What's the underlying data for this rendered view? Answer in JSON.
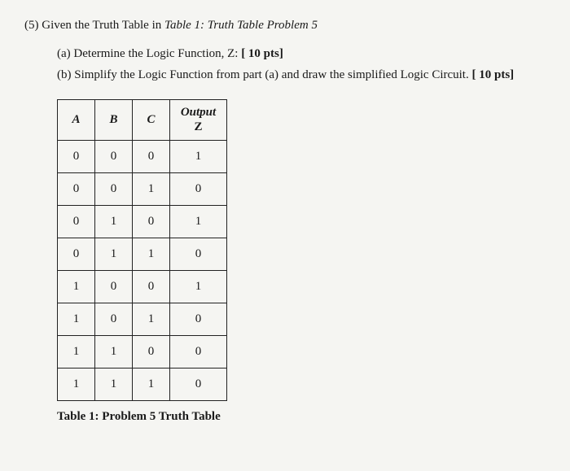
{
  "problem": {
    "number": "(5)",
    "intro_a": "Given the Truth Table in ",
    "intro_em": "Table 1: Truth Table Problem 5",
    "parts": {
      "a_label": "(a)",
      "a_text": "Determine the Logic Function, Z: ",
      "a_pts": "[ 10 pts]",
      "b_label": "(b)",
      "b_text": "Simplify the Logic Function from part (a) and draw the simplified Logic Circuit. ",
      "b_pts": "[ 10 pts]"
    }
  },
  "table": {
    "headers": {
      "A": "A",
      "B": "B",
      "C": "C",
      "out": "Output",
      "z": "Z"
    },
    "caption": "Table 1: Problem 5 Truth Table",
    "rows": [
      {
        "A": "0",
        "B": "0",
        "C": "0",
        "Z": "1"
      },
      {
        "A": "0",
        "B": "0",
        "C": "1",
        "Z": "0"
      },
      {
        "A": "0",
        "B": "1",
        "C": "0",
        "Z": "1"
      },
      {
        "A": "0",
        "B": "1",
        "C": "1",
        "Z": "0"
      },
      {
        "A": "1",
        "B": "0",
        "C": "0",
        "Z": "1"
      },
      {
        "A": "1",
        "B": "0",
        "C": "1",
        "Z": "0"
      },
      {
        "A": "1",
        "B": "1",
        "C": "0",
        "Z": "0"
      },
      {
        "A": "1",
        "B": "1",
        "C": "1",
        "Z": "0"
      }
    ]
  }
}
